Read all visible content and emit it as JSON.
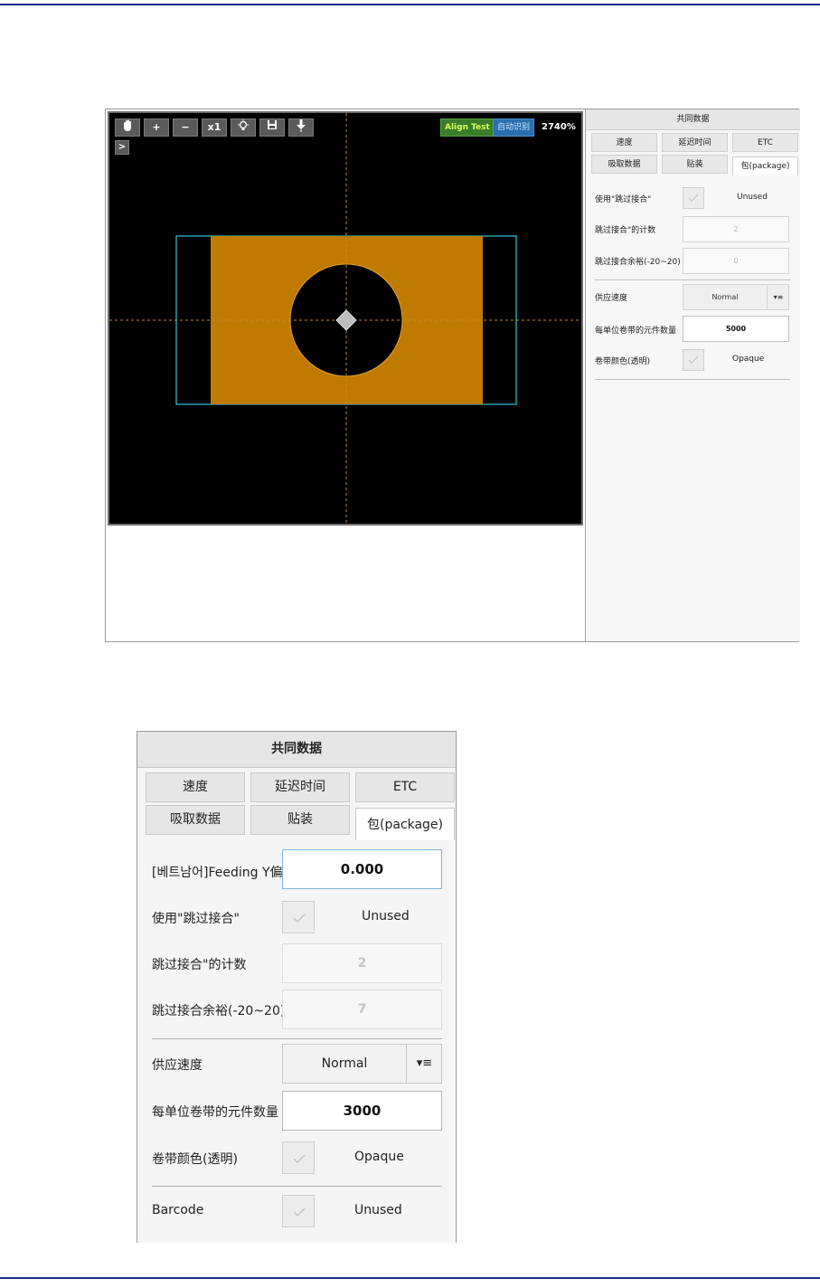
{
  "toolbar": {
    "zoom_in_label": "+",
    "zoom_out_label": "−",
    "scale_label": "x1",
    "expand_label": ">",
    "align_test_label": "Align Test",
    "auto_recognize_label": "自动识别",
    "zoom_level": "2740%"
  },
  "small_panel": {
    "title": "共同数据",
    "tabs_row1": [
      "速度",
      "延迟时间",
      "ETC"
    ],
    "tabs_row2": [
      "吸取数据",
      "贴装",
      "包(package)"
    ],
    "use_skip_label": "使用\"跳过接合\"",
    "use_skip_value": "Unused",
    "skip_count_label": "跳过接合\"的计数",
    "skip_count_value": "2",
    "skip_margin_label": "跳过接合余裕(-20~20)",
    "skip_margin_value": "0",
    "feed_speed_label": "供应速度",
    "feed_speed_value": "Normal",
    "tape_count_label": "每单位卷带的元件数量",
    "tape_count_value": "5000",
    "tape_color_label": "卷带颜色(透明)",
    "tape_color_value": "Opaque"
  },
  "large_panel": {
    "title": "共同数据",
    "tabs_row1": [
      "速度",
      "延迟时间",
      "ETC"
    ],
    "tabs_row2": [
      "吸取数据",
      "贴装",
      "包(package)"
    ],
    "feeding_y_label": "[베트남어]Feeding Y偏",
    "feeding_y_value": "0.000",
    "use_skip_label": "使用\"跳过接合\"",
    "use_skip_value": "Unused",
    "skip_count_label": "跳过接合\"的计数",
    "skip_count_value": "2",
    "skip_margin_label": "跳过接合余裕(-20~20)",
    "skip_margin_value": "7",
    "feed_speed_label": "供应速度",
    "feed_speed_value": "Normal",
    "feed_speed_button": "▾≡",
    "tape_count_label": "每单位卷带的元件数量",
    "tape_count_value": "3000",
    "tape_color_label": "卷带颜色(透明)",
    "tape_color_value": "Opaque",
    "barcode_label": "Barcode",
    "barcode_value": "Unused"
  },
  "colors": {
    "rule_line": "#1b2a8c",
    "component_body": "#c07a00",
    "bounding_box": "#2bc6d6",
    "crosshair": "#c08a30",
    "align_test_bg": "#3a7d2a",
    "align_test_text": "#d8ff5a",
    "auto_btn_bg": "#2a6fb0"
  }
}
